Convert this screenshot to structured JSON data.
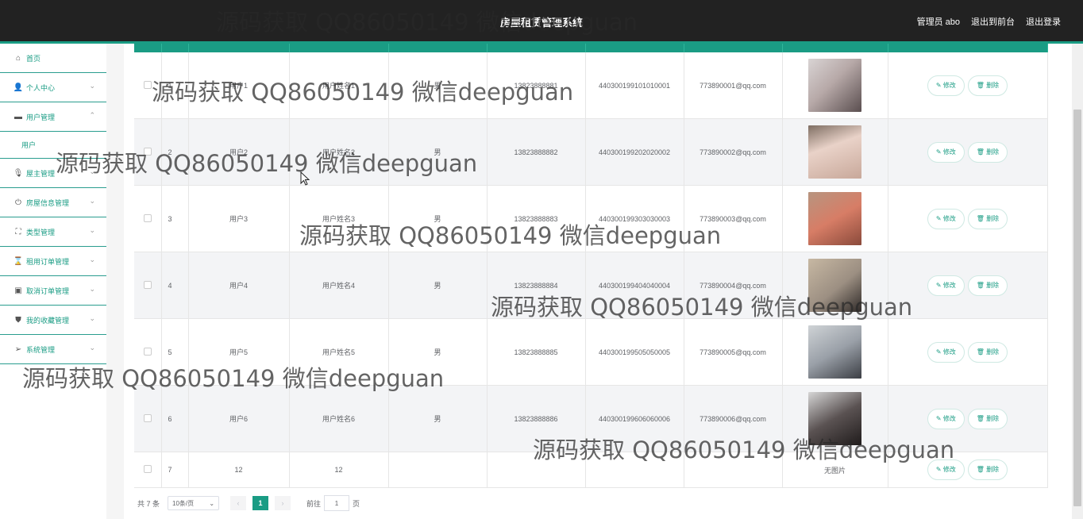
{
  "header": {
    "title": "房屋租赁管理系统",
    "admin_label": "管理员 abo",
    "exit_front": "退出到前台",
    "logout": "退出登录"
  },
  "sidebar": {
    "items": [
      {
        "label": "首页",
        "icon": "home-icon",
        "arrow": ""
      },
      {
        "label": "个人中心",
        "icon": "user-icon",
        "arrow": "⌄"
      },
      {
        "label": "用户管理",
        "icon": "folder-icon",
        "arrow": "⌃"
      },
      {
        "label": "屋主管理",
        "icon": "microphone-icon",
        "arrow": "⌄"
      },
      {
        "label": "房屋信息管理",
        "icon": "power-icon",
        "arrow": "⌄"
      },
      {
        "label": "类型管理",
        "icon": "expand-icon",
        "arrow": "⌄"
      },
      {
        "label": "租用订单管理",
        "icon": "hourglass-icon",
        "arrow": "⌄"
      },
      {
        "label": "取消订单管理",
        "icon": "briefcase-icon",
        "arrow": "⌄"
      },
      {
        "label": "我的收藏管理",
        "icon": "shield-icon",
        "arrow": "⌄"
      },
      {
        "label": "系统管理",
        "icon": "send-icon",
        "arrow": "⌄"
      }
    ],
    "submenu": {
      "label": "用户"
    }
  },
  "table": {
    "rows": [
      {
        "index": "1",
        "account": "用户1",
        "name": "用户姓名1",
        "gender": "男",
        "phone": "13823888881",
        "id_card": "440300199101010001",
        "email": "773890001@qq.com",
        "photo": "avatar-1",
        "edit": "修改",
        "delete": "删除"
      },
      {
        "index": "2",
        "account": "用户2",
        "name": "用户姓名2",
        "gender": "男",
        "phone": "13823888882",
        "id_card": "440300199202020002",
        "email": "773890002@qq.com",
        "photo": "avatar-2",
        "edit": "修改",
        "delete": "删除"
      },
      {
        "index": "3",
        "account": "用户3",
        "name": "用户姓名3",
        "gender": "男",
        "phone": "13823888883",
        "id_card": "440300199303030003",
        "email": "773890003@qq.com",
        "photo": "avatar-3",
        "edit": "修改",
        "delete": "删除"
      },
      {
        "index": "4",
        "account": "用户4",
        "name": "用户姓名4",
        "gender": "男",
        "phone": "13823888884",
        "id_card": "440300199404040004",
        "email": "773890004@qq.com",
        "photo": "avatar-4",
        "edit": "修改",
        "delete": "删除"
      },
      {
        "index": "5",
        "account": "用户5",
        "name": "用户姓名5",
        "gender": "男",
        "phone": "13823888885",
        "id_card": "440300199505050005",
        "email": "773890005@qq.com",
        "photo": "avatar-5",
        "edit": "修改",
        "delete": "删除"
      },
      {
        "index": "6",
        "account": "用户6",
        "name": "用户姓名6",
        "gender": "男",
        "phone": "13823888886",
        "id_card": "440300199606060006",
        "email": "773890006@qq.com",
        "photo": "avatar-6",
        "edit": "修改",
        "delete": "删除"
      },
      {
        "index": "7",
        "account": "12",
        "name": "12",
        "gender": "",
        "phone": "",
        "id_card": "",
        "email": "",
        "photo": "无图片",
        "edit": "修改",
        "delete": "删除"
      }
    ]
  },
  "pagination": {
    "total": "共 7 条",
    "page_size": "10条/页",
    "current_page": "1",
    "goto_label": "前往",
    "goto_value": "1",
    "page_unit": "页"
  },
  "watermark": {
    "text": "源码获取 QQ86050149 微信deepguan"
  },
  "colors": {
    "accent": "#1a9c84",
    "header_bg": "#222222"
  }
}
